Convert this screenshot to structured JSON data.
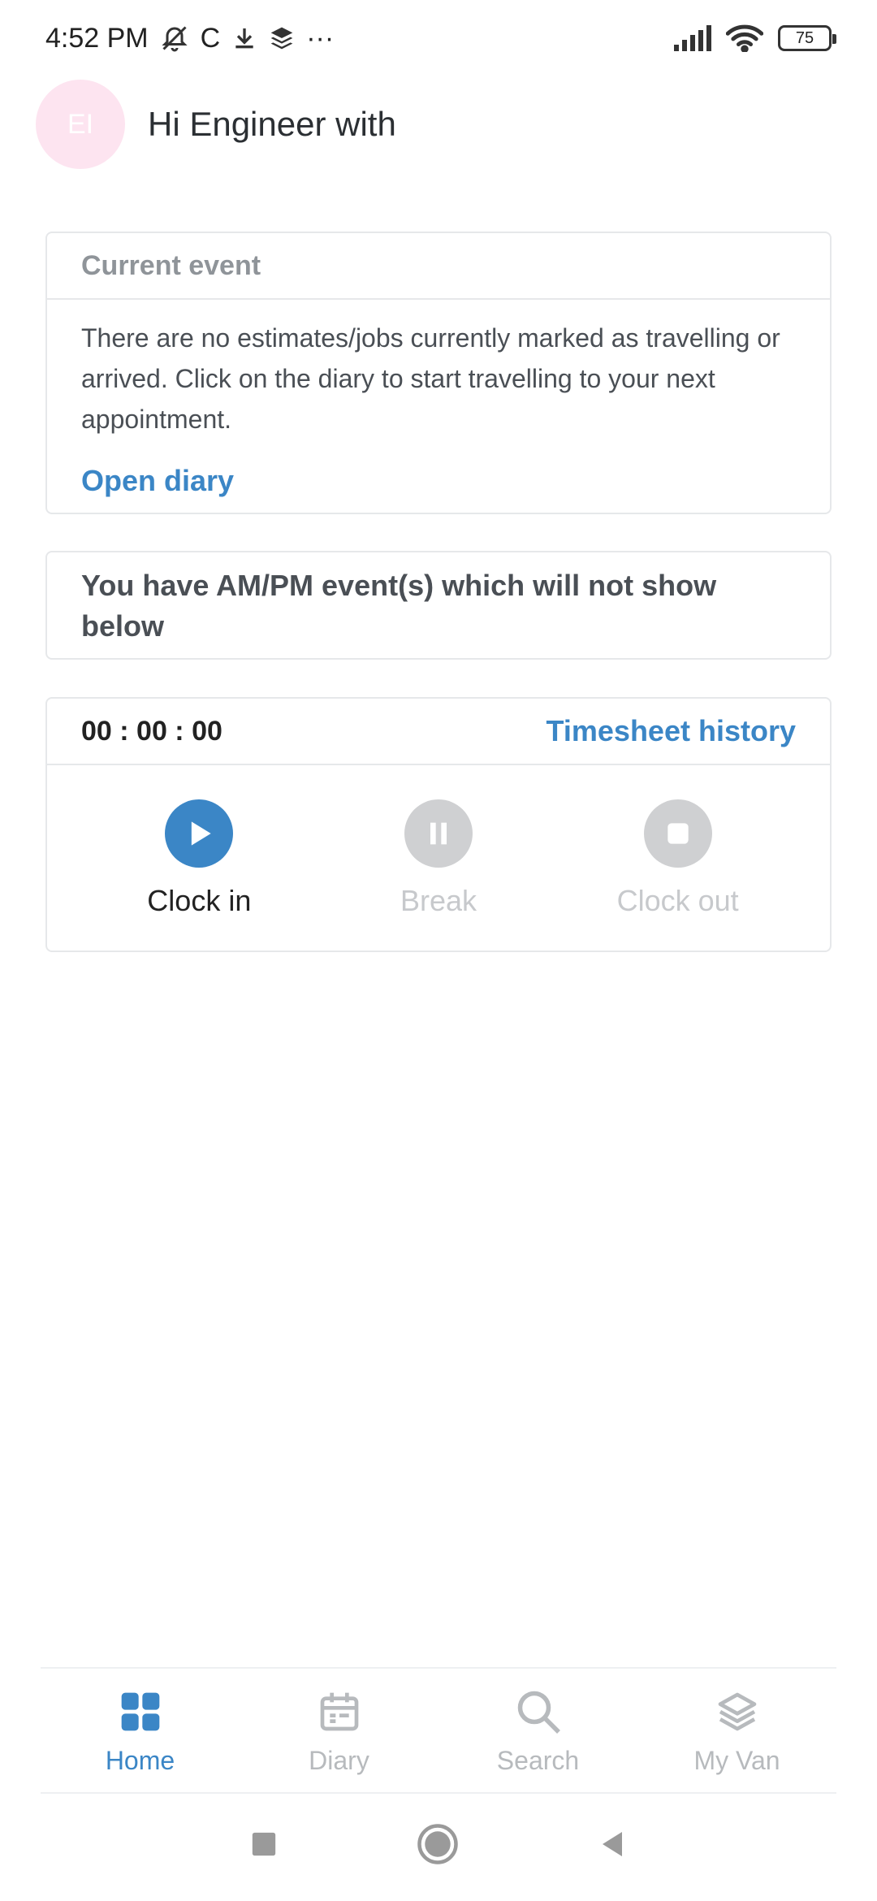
{
  "status_bar": {
    "time": "4:52 PM",
    "carrier_letter": "C",
    "more": "···",
    "battery": "75"
  },
  "header": {
    "avatar_initials": "EI",
    "greeting": "Hi Engineer with"
  },
  "current_event": {
    "title": "Current event",
    "message": "There are no estimates/jobs currently marked as travelling or arrived. Click on the diary to start travelling to your next appointment.",
    "link": "Open diary"
  },
  "notice": {
    "text": "You have AM/PM event(s) which will not show below"
  },
  "timesheet": {
    "timer": "00 : 00 : 00",
    "history_link": "Timesheet history",
    "actions": [
      {
        "label": "Clock in",
        "state": "active",
        "icon": "play-icon"
      },
      {
        "label": "Break",
        "state": "disabled",
        "icon": "pause-icon"
      },
      {
        "label": "Clock out",
        "state": "disabled",
        "icon": "stop-icon"
      }
    ]
  },
  "bottom_nav": {
    "items": [
      {
        "label": "Home",
        "icon": "grid-icon",
        "active": true
      },
      {
        "label": "Diary",
        "icon": "calendar-icon",
        "active": false
      },
      {
        "label": "Search",
        "icon": "search-icon",
        "active": false
      },
      {
        "label": "My Van",
        "icon": "layers-icon",
        "active": false
      }
    ]
  },
  "colors": {
    "accent": "#3b86c6",
    "disabled": "#cfd0d2",
    "avatar_bg": "#fde4f0"
  }
}
